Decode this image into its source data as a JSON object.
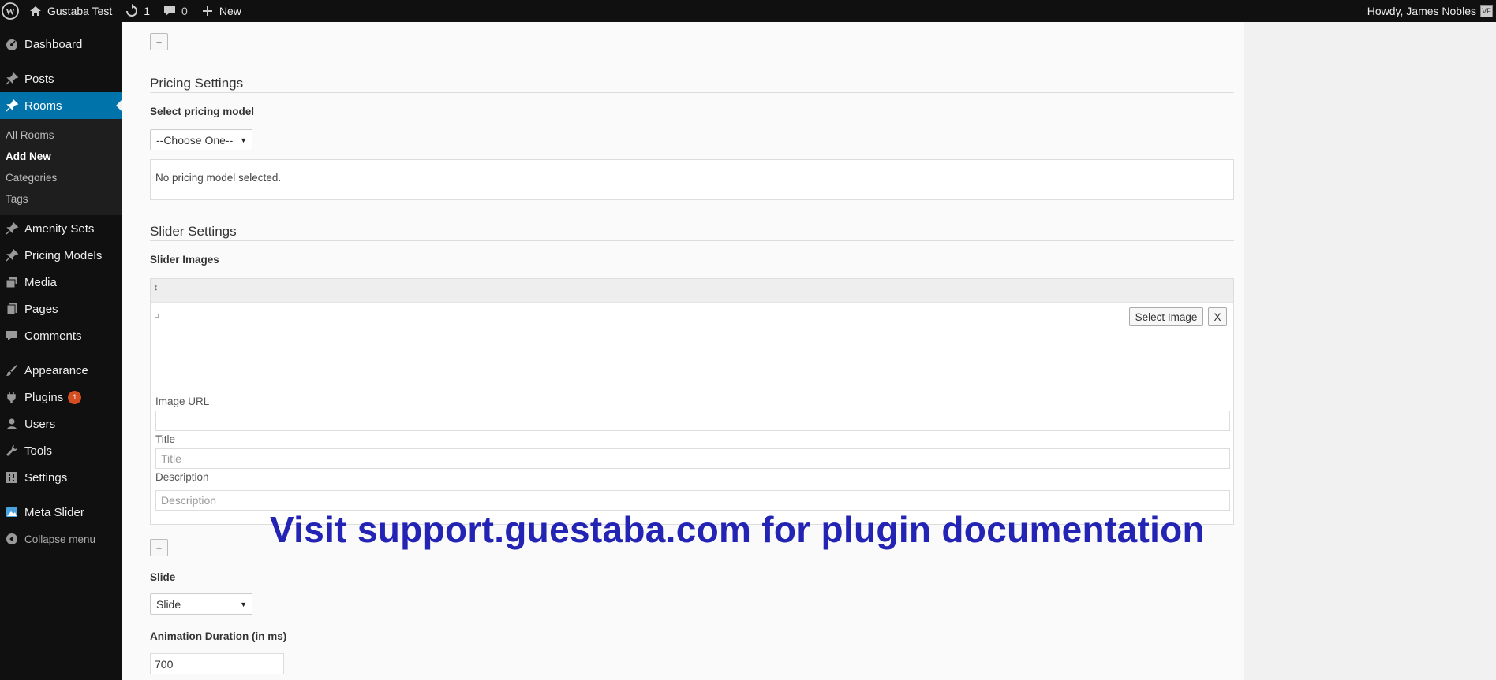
{
  "admin_bar": {
    "site_name": "Gustaba Test",
    "updates_count": "1",
    "comments_count": "0",
    "new_label": "New",
    "howdy": "Howdy, James Nobles",
    "avatar_text": "VF"
  },
  "sidebar": {
    "items": [
      {
        "label": "Dashboard",
        "icon": "dashboard-icon"
      },
      {
        "label": "Posts",
        "icon": "pin-icon"
      },
      {
        "label": "Rooms",
        "icon": "pin-icon"
      },
      {
        "label": "Amenity Sets",
        "icon": "pin-icon"
      },
      {
        "label": "Pricing Models",
        "icon": "pin-icon"
      },
      {
        "label": "Media",
        "icon": "media-icon"
      },
      {
        "label": "Pages",
        "icon": "pages-icon"
      },
      {
        "label": "Comments",
        "icon": "comments-icon"
      },
      {
        "label": "Appearance",
        "icon": "brush-icon"
      },
      {
        "label": "Plugins",
        "icon": "plugin-icon",
        "badge": "1"
      },
      {
        "label": "Users",
        "icon": "users-icon"
      },
      {
        "label": "Tools",
        "icon": "wrench-icon"
      },
      {
        "label": "Settings",
        "icon": "settings-icon"
      },
      {
        "label": "Meta Slider",
        "icon": "image-icon"
      }
    ],
    "submenu": [
      "All Rooms",
      "Add New",
      "Categories",
      "Tags"
    ],
    "collapse_label": "Collapse menu"
  },
  "main": {
    "top_add": "+",
    "pricing": {
      "title": "Pricing Settings",
      "select_label": "Select pricing model",
      "select_value": "--Choose One--",
      "info": "No pricing model selected."
    },
    "slider": {
      "title": "Slider Settings",
      "images_label": "Slider Images",
      "handle": "↕",
      "select_image": "Select Image",
      "remove": "X",
      "image_url_label": "Image URL",
      "image_url_value": "",
      "title_label": "Title",
      "title_placeholder": "Title",
      "description_label": "Description",
      "description_placeholder": "Description",
      "add": "+",
      "slide_label": "Slide",
      "slide_value": "Slide",
      "duration_label": "Animation Duration (in ms)",
      "duration_value": "700"
    },
    "watermark": "Visit support.guestaba.com for plugin documentation"
  }
}
